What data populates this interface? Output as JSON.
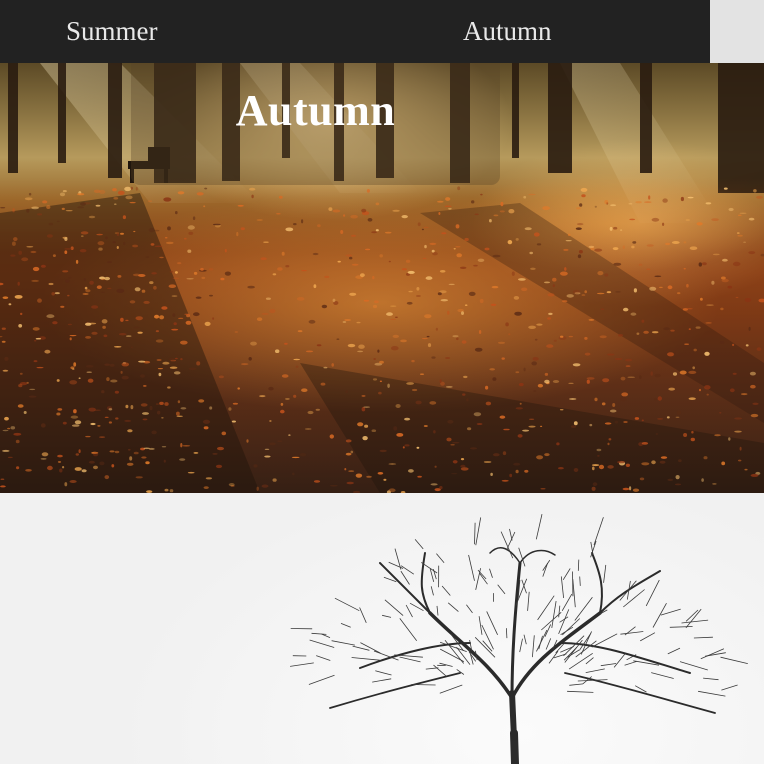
{
  "nav": {
    "items": [
      {
        "label": "Summer"
      },
      {
        "label": "Autumn"
      }
    ]
  },
  "hero": {
    "title": "Autumn",
    "image_subject": "forest path covered in fallen autumn leaves with sunlight through trees"
  },
  "next_section": {
    "image_subject": "bare leafless tree against a pale sky"
  },
  "colors": {
    "nav_background": "#222222",
    "nav_text": "#e9e9e9",
    "nav_right_background": "#e3e3e3",
    "hero_title_text": "#ffffff",
    "winter_background": "#f6f6f6",
    "tree_color": "#2b2b2b"
  }
}
